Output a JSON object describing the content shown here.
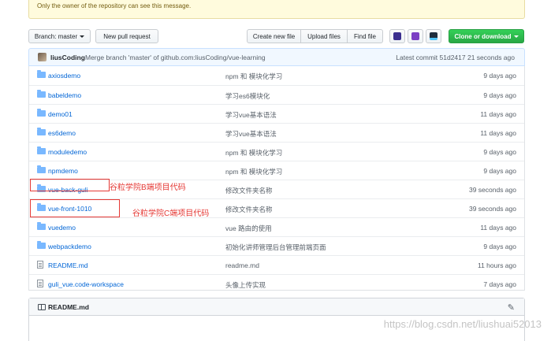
{
  "notice": {
    "text": "Only the owner of the repository can see this message."
  },
  "toolbar": {
    "branch_label": "Branch: master",
    "new_pull_request": "New pull request",
    "create_new_file": "Create new file",
    "upload_files": "Upload files",
    "find_file": "Find file",
    "extension_icons": [
      "extension-icon-1",
      "extension-icon-2",
      "extension-icon-3"
    ],
    "clone_label": "Clone or download",
    "clone_color": "#28a745"
  },
  "commit": {
    "author": "liusCoding",
    "message": "Merge branch 'master' of github.com:liusCoding/vue-learning",
    "latest": "Latest commit 51d2417 21 seconds ago"
  },
  "files": [
    {
      "type": "folder",
      "name": "axiosdemo",
      "message": "npm 和 模块化学习",
      "age": "9 days ago"
    },
    {
      "type": "folder",
      "name": "babeldemo",
      "message": "学习es6模块化",
      "age": "9 days ago"
    },
    {
      "type": "folder",
      "name": "demo01",
      "message": "学习vue基本语法",
      "age": "11 days ago"
    },
    {
      "type": "folder",
      "name": "es6demo",
      "message": "学习vue基本语法",
      "age": "11 days ago"
    },
    {
      "type": "folder",
      "name": "moduledemo",
      "message": "npm 和 模块化学习",
      "age": "9 days ago"
    },
    {
      "type": "folder",
      "name": "npmdemo",
      "message": "npm 和 模块化学习",
      "age": "9 days ago"
    },
    {
      "type": "folder",
      "name": "vue-back-guli",
      "message": "修改文件夹名称",
      "age": "39 seconds ago"
    },
    {
      "type": "folder",
      "name": "vue-front-1010",
      "message": "修改文件夹名称",
      "age": "39 seconds ago"
    },
    {
      "type": "folder",
      "name": "vuedemo",
      "message": "vue 路由的使用",
      "age": "11 days ago"
    },
    {
      "type": "folder",
      "name": "webpackdemo",
      "message": "初始化讲师管理后台管理前端页面",
      "age": "9 days ago"
    },
    {
      "type": "file",
      "name": "README.md",
      "message": "readme.md",
      "age": "11 hours ago"
    },
    {
      "type": "file",
      "name": "guli_vue.code-workspace",
      "message": "头像上传实现",
      "age": "7 days ago"
    }
  ],
  "annotations": {
    "back": "谷粒学院B端项目代码",
    "front": "谷粒学院C端项目代码",
    "color": "#e53935"
  },
  "readme": {
    "title": "README.md"
  },
  "watermark": "https://blog.csdn.net/liushuai52013"
}
